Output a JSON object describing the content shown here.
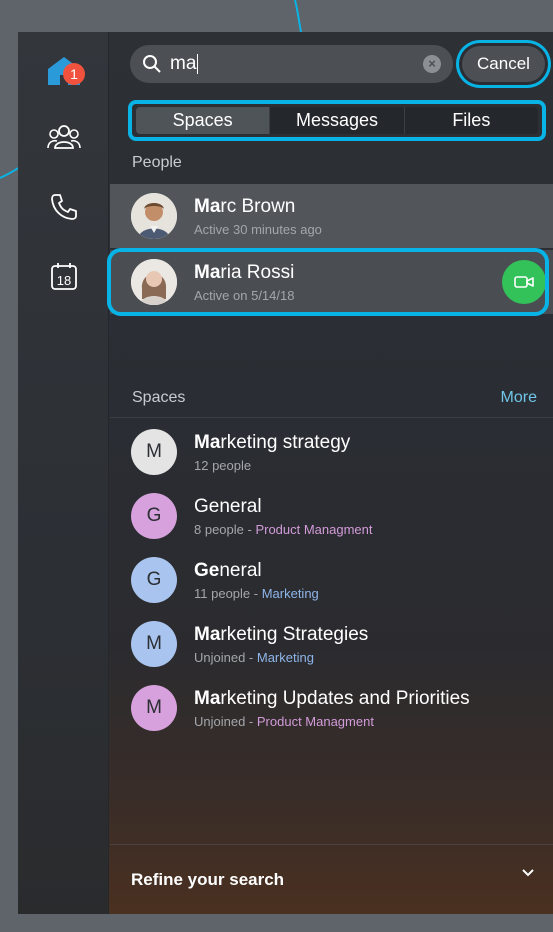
{
  "rail": {
    "home_badge": "1",
    "calendar_day": "18"
  },
  "search": {
    "value": "ma",
    "cancel_label": "Cancel"
  },
  "tabs": [
    {
      "label": "Spaces",
      "active": true
    },
    {
      "label": "Messages",
      "active": false
    },
    {
      "label": "Files",
      "active": false
    }
  ],
  "people": {
    "title": "People",
    "items": [
      {
        "match": "Ma",
        "rest": "rc Brown",
        "status": "Active 30 minutes ago"
      },
      {
        "match": "Ma",
        "rest": "ria Rossi",
        "status": "Active on 5/14/18"
      }
    ]
  },
  "spaces": {
    "title": "Spaces",
    "more_label": "More",
    "items": [
      {
        "initial": "M",
        "match": "Ma",
        "rest": "rketing strategy",
        "meta": "12 people",
        "team": "",
        "color": "#e4e4e4"
      },
      {
        "initial": "G",
        "match": "",
        "rest": "General",
        "meta": "8 people - ",
        "team": "Product Managment",
        "color": "#d6a1dc"
      },
      {
        "initial": "G",
        "match": "Ge",
        "rest": "neral",
        "meta": "11 people - ",
        "team": "Marketing",
        "color": "#a9c4ee"
      },
      {
        "initial": "M",
        "match": "Ma",
        "rest": "rketing Strategies",
        "meta": "Unjoined - ",
        "team": "Marketing",
        "color": "#a9c4ee"
      },
      {
        "initial": "M",
        "match": "Ma",
        "rest": "rketing Updates and Priorities",
        "meta": "Unjoined - ",
        "team": "Product Managment",
        "color": "#d6a1dc"
      }
    ]
  },
  "footer": {
    "refine_label": "Refine your search"
  },
  "colors": {
    "accent": "#08b3e6",
    "badge": "#f0523d",
    "video": "#33c15a"
  }
}
